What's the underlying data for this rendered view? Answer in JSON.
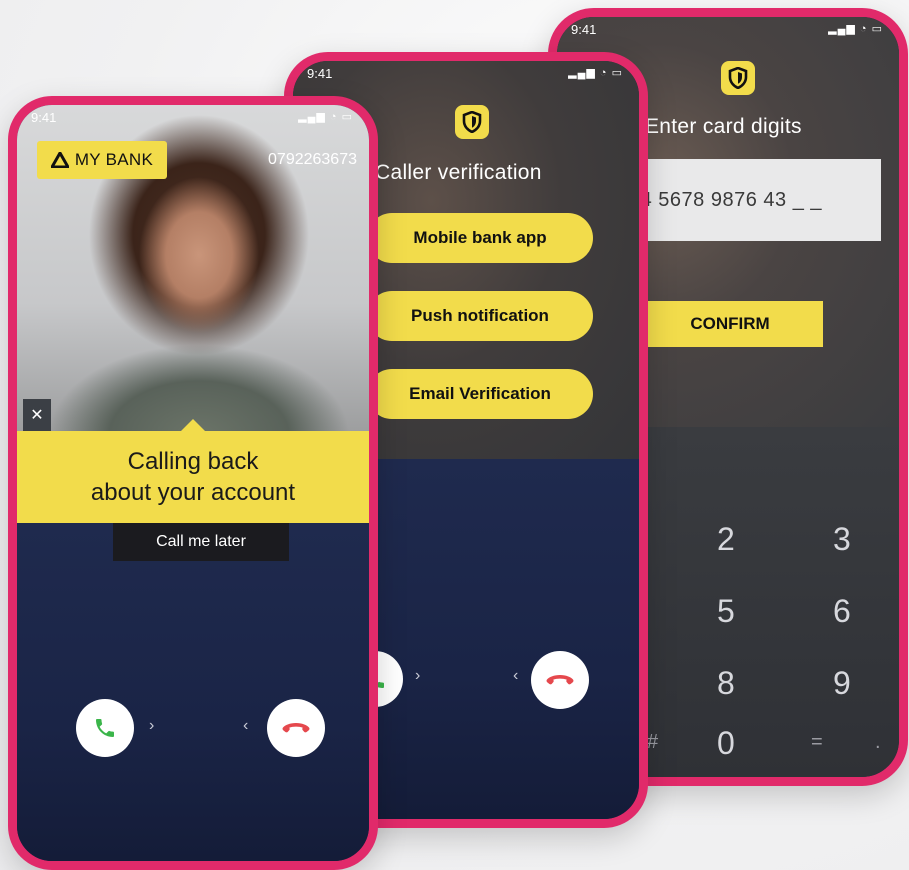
{
  "phone3": {
    "status_time": "9:41",
    "title": "Enter card digits",
    "card_input_value": "34 5678 9876 43 _ _",
    "confirm_label": "CONFIRM",
    "keypad": {
      "k2": "2",
      "k3": "3",
      "k5": "5",
      "k6": "6",
      "k8": "8",
      "k9": "9",
      "k0": "0",
      "hash": "#",
      "equals": "=",
      "dot": "."
    }
  },
  "phone2": {
    "status_time": "9:41",
    "title": "Caller verification",
    "options": [
      "Mobile bank app",
      "Push notification",
      "Email Verification"
    ]
  },
  "phone1": {
    "status_time": "9:41",
    "bank_name": "MY BANK",
    "caller_number": "0792263673",
    "message_line1": "Calling back",
    "message_line2": "about your account",
    "later_label": "Call me later"
  },
  "colors": {
    "frame": "#e12a6a",
    "accent_yellow": "#f2dc4b",
    "navy": "#1f2a4e",
    "accept_green": "#3bb54a",
    "decline_red": "#e5484d"
  },
  "icons": [
    "shield-icon",
    "phone-accept-icon",
    "phone-decline-icon",
    "close-icon",
    "chevron-right-icon",
    "chevron-left-icon",
    "signal-icon",
    "wifi-icon",
    "battery-icon",
    "bank-logo-triangle-icon"
  ]
}
